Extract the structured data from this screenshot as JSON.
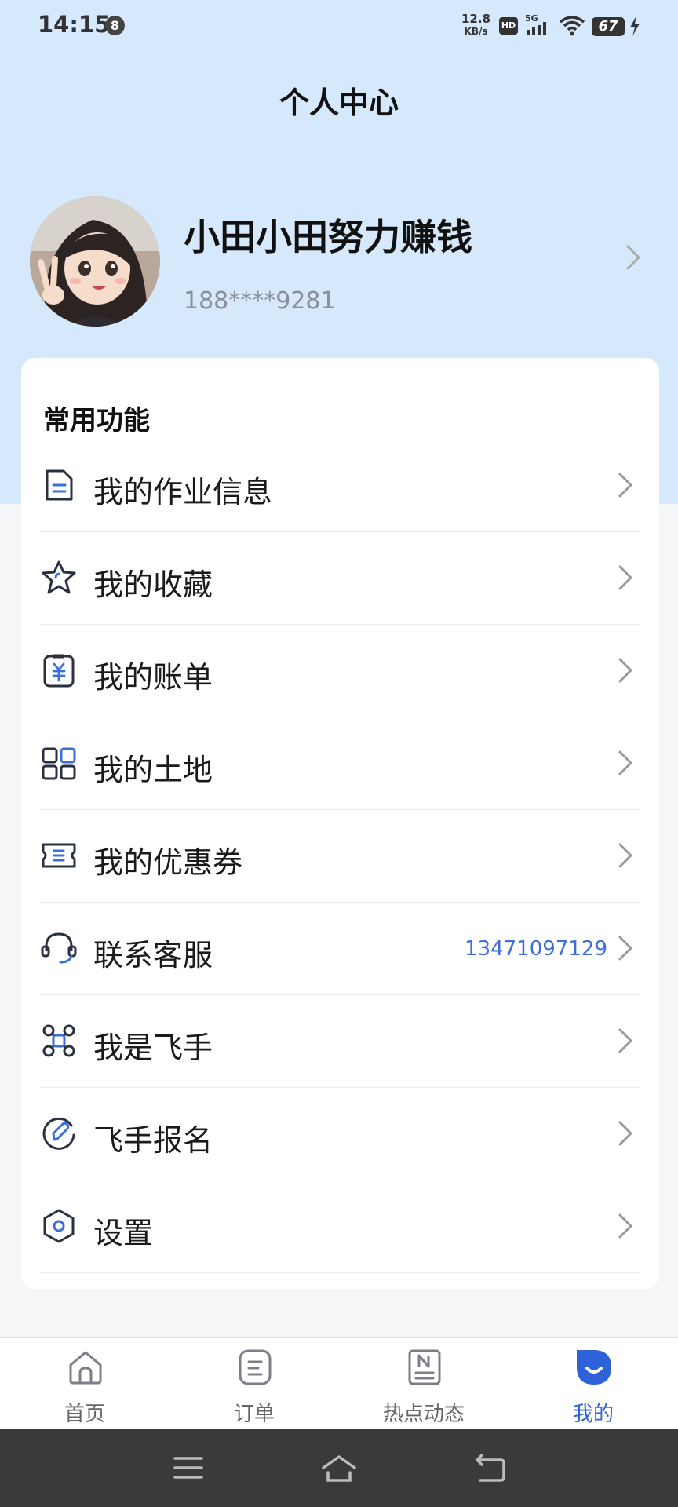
{
  "status_bar": {
    "time": "14:15",
    "notification_badge": "8",
    "net_speed_value": "12.8",
    "net_speed_unit": "KB/s",
    "hd_label": "HD",
    "network_label": "5G",
    "battery": "67",
    "icons": [
      "hd-icon",
      "signal-5g-icon",
      "wifi-icon",
      "battery-icon",
      "charging-icon"
    ]
  },
  "header": {
    "title": "个人中心"
  },
  "profile": {
    "name": "小田小田努力赚钱",
    "phone": "188****9281"
  },
  "menu": {
    "section_title": "常用功能",
    "items": [
      {
        "label": "我的作业信息",
        "icon": "document-icon",
        "extra": ""
      },
      {
        "label": "我的收藏",
        "icon": "star-icon",
        "extra": ""
      },
      {
        "label": "我的账单",
        "icon": "bill-icon",
        "extra": ""
      },
      {
        "label": "我的土地",
        "icon": "land-grid-icon",
        "extra": ""
      },
      {
        "label": "我的优惠券",
        "icon": "coupon-icon",
        "extra": ""
      },
      {
        "label": "联系客服",
        "icon": "headset-icon",
        "extra": "13471097129"
      },
      {
        "label": "我是飞手",
        "icon": "drone-icon",
        "extra": ""
      },
      {
        "label": "飞手报名",
        "icon": "signup-icon",
        "extra": ""
      },
      {
        "label": "设置",
        "icon": "settings-hexagon-icon",
        "extra": ""
      }
    ]
  },
  "tab_bar": {
    "active_tab": "我的",
    "tabs": [
      {
        "label": "首页",
        "icon": "home-icon"
      },
      {
        "label": "订单",
        "icon": "order-icon"
      },
      {
        "label": "热点动态",
        "icon": "news-icon"
      },
      {
        "label": "我的",
        "icon": "profile-icon"
      }
    ]
  },
  "colors": {
    "header_bg": "#d6e8fc",
    "accent": "#2d62d8",
    "phone_link": "#3f6fd6",
    "icon_dark": "#2a3040",
    "icon_accent": "#3a6fe0"
  }
}
